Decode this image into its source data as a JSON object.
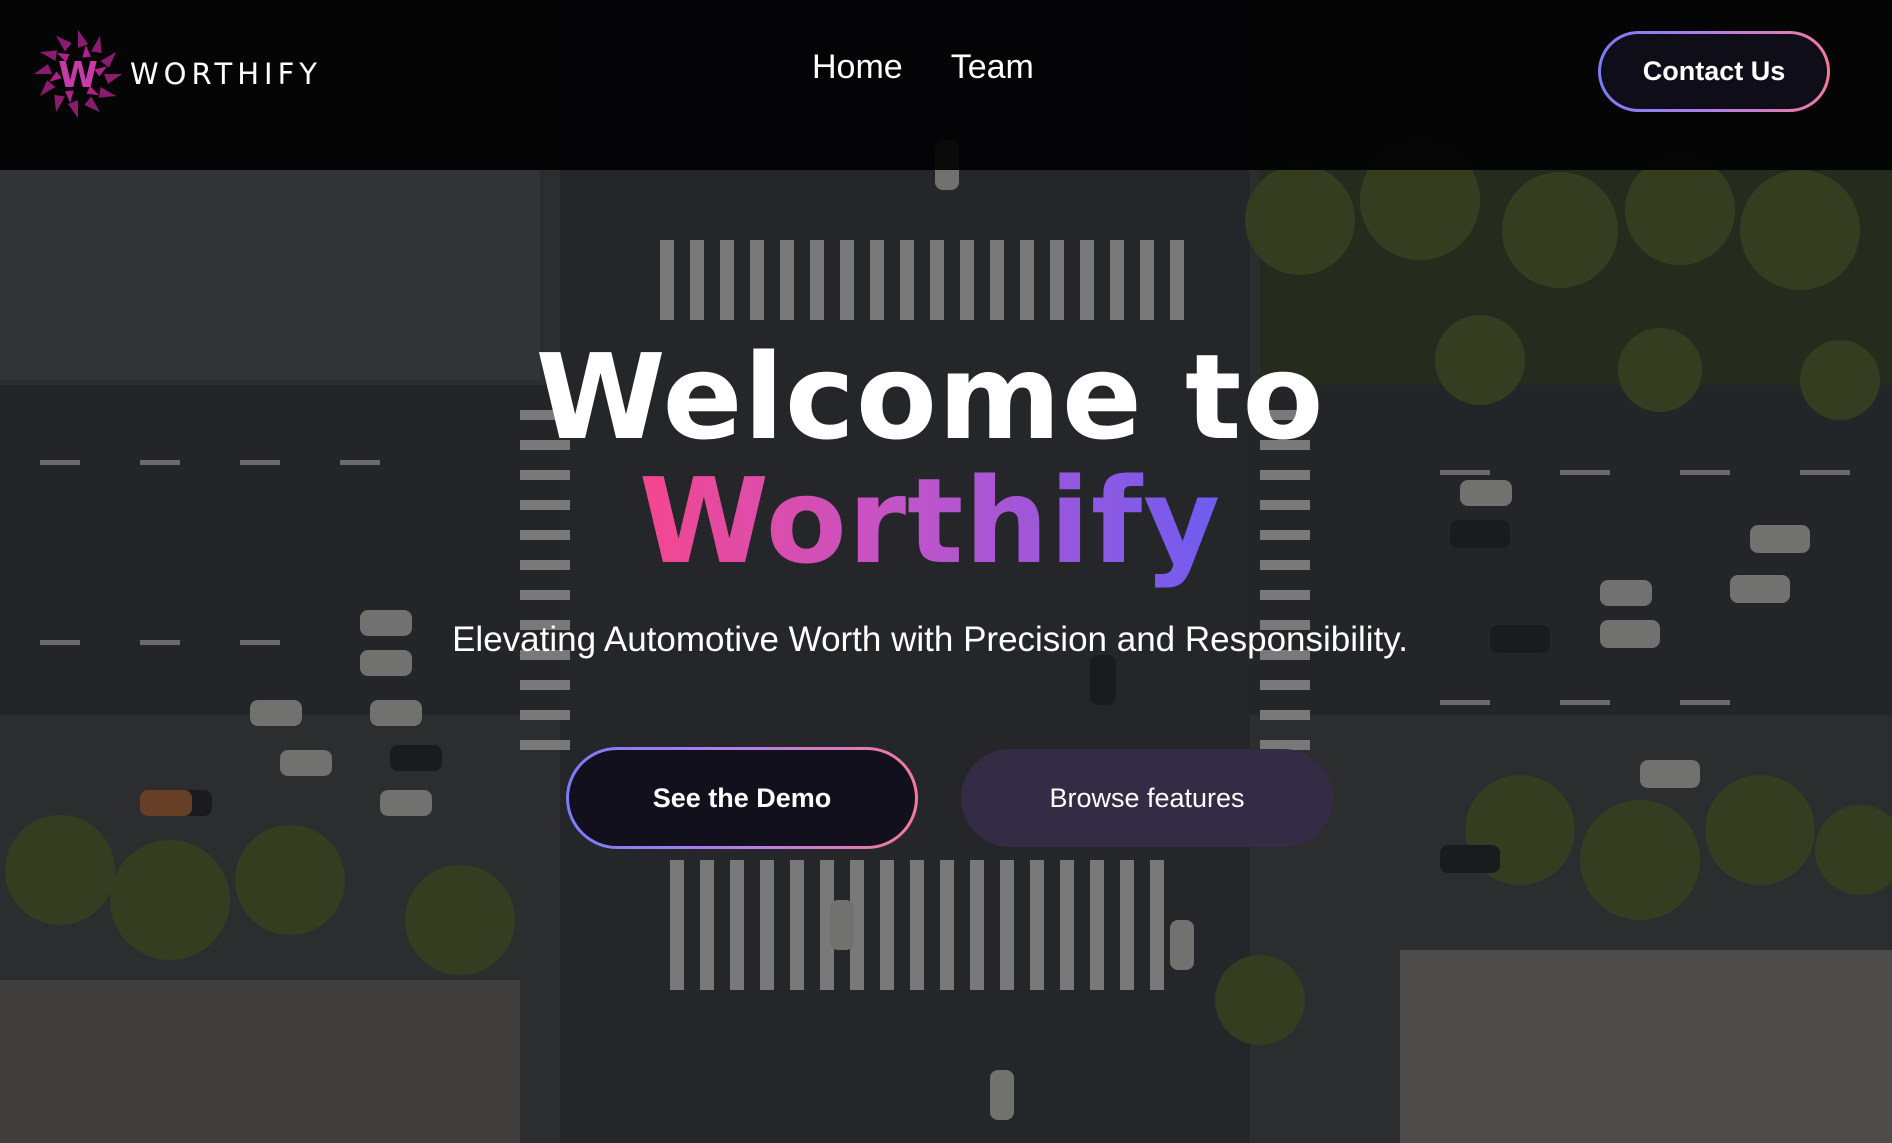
{
  "brand": {
    "name": "WORTHIFY",
    "logo_letter": "W",
    "logo_icon": "pinwheel-logo-icon"
  },
  "nav": {
    "links": [
      {
        "label": "Home"
      },
      {
        "label": "Team"
      }
    ],
    "contact_label": "Contact Us"
  },
  "hero": {
    "title_line_1": "Welcome to",
    "title_line_2": "Worthify",
    "subtitle": "Elevating Automotive Worth with Precision and Responsibility.",
    "primary_cta": "See the Demo",
    "secondary_cta": "Browse features"
  },
  "colors": {
    "accent_gradient_start": "#f5468e",
    "accent_gradient_mid": "#c254c8",
    "accent_gradient_end": "#6e5cf2",
    "button_border_start": "#7b7cf8",
    "button_border_end": "#f47a9a",
    "secondary_button_bg": "#332c44",
    "navbar_bg": "#020203"
  }
}
